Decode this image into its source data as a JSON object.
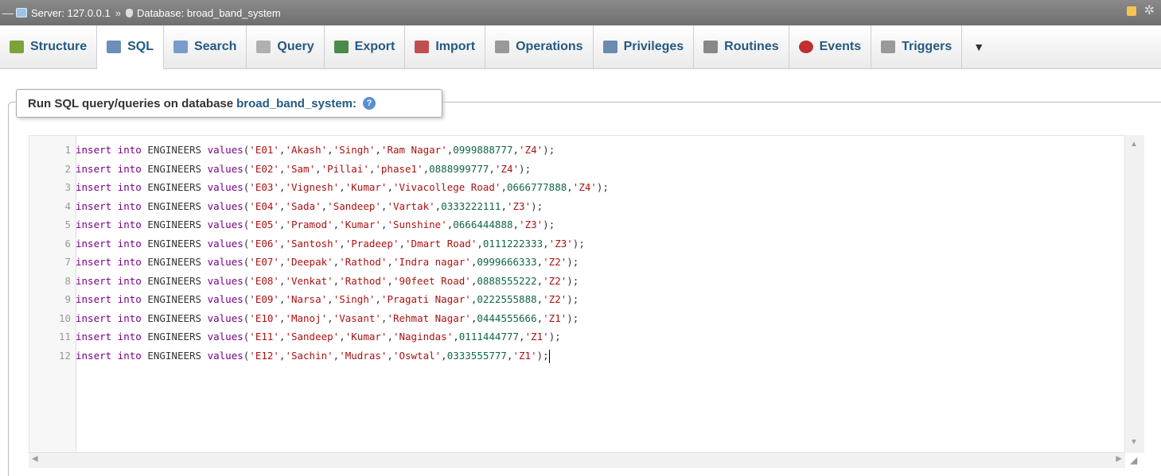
{
  "breadcrumb": {
    "collapse_glyph": "—",
    "server_label": "Server: 127.0.0.1",
    "separator": "»",
    "database_label": "Database: broad_band_system"
  },
  "tabs": [
    {
      "label": "Structure",
      "icon": "structure-icon",
      "active": false
    },
    {
      "label": "SQL",
      "icon": "sql-icon",
      "active": true
    },
    {
      "label": "Search",
      "icon": "search-icon",
      "active": false
    },
    {
      "label": "Query",
      "icon": "query-icon",
      "active": false
    },
    {
      "label": "Export",
      "icon": "export-icon",
      "active": false
    },
    {
      "label": "Import",
      "icon": "import-icon",
      "active": false
    },
    {
      "label": "Operations",
      "icon": "wrench-icon",
      "active": false
    },
    {
      "label": "Privileges",
      "icon": "privileges-icon",
      "active": false
    },
    {
      "label": "Routines",
      "icon": "routines-icon",
      "active": false
    },
    {
      "label": "Events",
      "icon": "clock-icon",
      "active": false
    },
    {
      "label": "Triggers",
      "icon": "triggers-icon",
      "active": false
    }
  ],
  "more_glyph": "▼",
  "panel": {
    "title": "Run SQL query/queries on database",
    "database": "broad_band_system:",
    "help_glyph": "?"
  },
  "editor": {
    "lines": [
      {
        "n": "1",
        "id": "E01",
        "first": "Akash",
        "last": "Singh",
        "addr": "Ram Nagar",
        "phone": "0999888777",
        "zone": "Z4"
      },
      {
        "n": "2",
        "id": "E02",
        "first": "Sam",
        "last": "Pillai",
        "addr": "phase1",
        "phone": "0888999777",
        "zone": "Z4"
      },
      {
        "n": "3",
        "id": "E03",
        "first": "Vignesh",
        "last": "Kumar",
        "addr": "Vivacollege Road",
        "phone": "0666777888",
        "zone": "Z4"
      },
      {
        "n": "4",
        "id": "E04",
        "first": "Sada",
        "last": "Sandeep",
        "addr": "Vartak",
        "phone": "0333222111",
        "zone": "Z3"
      },
      {
        "n": "5",
        "id": "E05",
        "first": "Pramod",
        "last": "Kumar",
        "addr": "Sunshine",
        "phone": "0666444888",
        "zone": "Z3"
      },
      {
        "n": "6",
        "id": "E06",
        "first": "Santosh",
        "last": "Pradeep",
        "addr": "Dmart Road",
        "phone": "0111222333",
        "zone": "Z3"
      },
      {
        "n": "7",
        "id": "E07",
        "first": "Deepak",
        "last": "Rathod",
        "addr": "Indra nagar",
        "phone": "0999666333",
        "zone": "Z2"
      },
      {
        "n": "8",
        "id": "E08",
        "first": "Venkat",
        "last": "Rathod",
        "addr": "90feet Road",
        "phone": "0888555222",
        "zone": "Z2"
      },
      {
        "n": "9",
        "id": "E09",
        "first": "Narsa",
        "last": "Singh",
        "addr": "Pragati Nagar",
        "phone": "0222555888",
        "zone": "Z2"
      },
      {
        "n": "10",
        "id": "E10",
        "first": "Manoj",
        "last": "Vasant",
        "addr": "Rehmat Nagar",
        "phone": "0444555666",
        "zone": "Z1"
      },
      {
        "n": "11",
        "id": "E11",
        "first": "Sandeep",
        "last": "Kumar",
        "addr": "Nagindas",
        "phone": "0111444777",
        "zone": "Z1"
      },
      {
        "n": "12",
        "id": "E12",
        "first": "Sachin",
        "last": "Mudras",
        "addr": "Oswtal",
        "phone": "0333555777",
        "zone": "Z1"
      }
    ],
    "kw_insert": "insert into",
    "table": "ENGINEERS",
    "kw_values": "values"
  },
  "scroll": {
    "up": "▲",
    "down": "▼",
    "left": "◀",
    "right": "▶",
    "grip": "◢"
  }
}
